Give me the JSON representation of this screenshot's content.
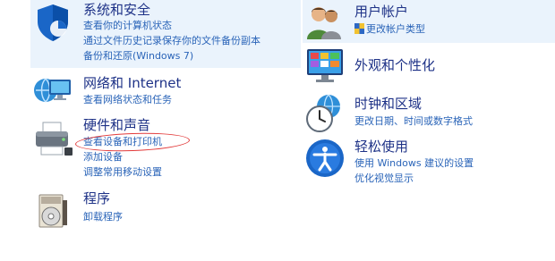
{
  "system_security": {
    "title": "系统和安全",
    "links": [
      "查看你的计算机状态",
      "通过文件历史记录保存你的文件备份副本",
      "备份和还原(Windows 7)"
    ]
  },
  "network": {
    "title": "网络和 Internet",
    "links": [
      "查看网络状态和任务"
    ]
  },
  "hardware_sound": {
    "title": "硬件和声音",
    "links": [
      "查看设备和打印机",
      "添加设备",
      "调整常用移动设置"
    ]
  },
  "programs": {
    "title": "程序",
    "links": [
      "卸载程序"
    ]
  },
  "user_accounts": {
    "title": "用户帐户",
    "links": [
      "更改帐户类型"
    ]
  },
  "appearance": {
    "title": "外观和个性化"
  },
  "clock_region": {
    "title": "时钟和区域",
    "links": [
      "更改日期、时间或数字格式"
    ]
  },
  "ease_access": {
    "title": "轻松使用",
    "links": [
      "使用 Windows 建议的设置",
      "优化视觉显示"
    ]
  },
  "colors": {
    "title_color": "#1e3287",
    "link_color": "#2a64b8",
    "highlight_bg": "#eaf3fc",
    "annotation_red": "#e23a3a"
  }
}
